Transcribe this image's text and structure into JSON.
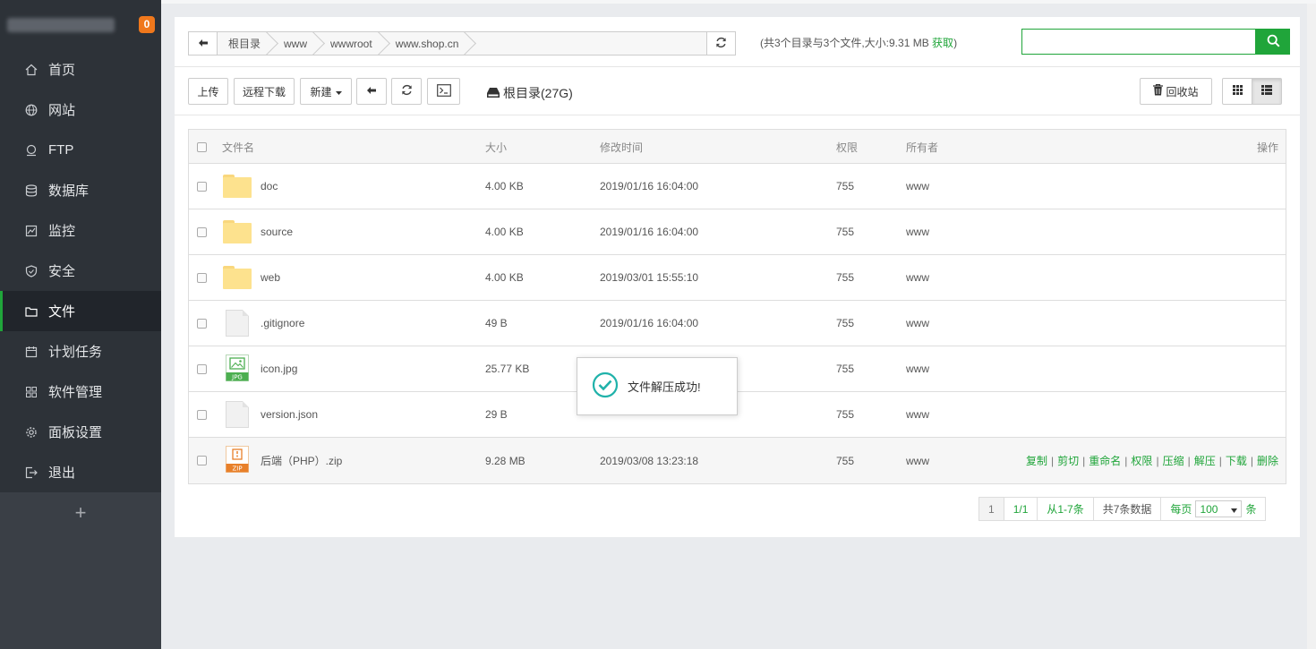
{
  "sidebar": {
    "badge": "0",
    "items": [
      {
        "label": "首页",
        "icon": "home-icon"
      },
      {
        "label": "网站",
        "icon": "globe-icon"
      },
      {
        "label": "FTP",
        "icon": "ftp-icon"
      },
      {
        "label": "数据库",
        "icon": "database-icon"
      },
      {
        "label": "监控",
        "icon": "monitor-icon"
      },
      {
        "label": "安全",
        "icon": "shield-icon"
      },
      {
        "label": "文件",
        "icon": "folder-icon"
      },
      {
        "label": "计划任务",
        "icon": "calendar-icon"
      },
      {
        "label": "软件管理",
        "icon": "grid-icon"
      },
      {
        "label": "面板设置",
        "icon": "gear-icon"
      },
      {
        "label": "退出",
        "icon": "logout-icon"
      }
    ],
    "active_index": 6,
    "add_label": "+"
  },
  "path": {
    "crumbs": [
      "根目录",
      "www",
      "wwwroot",
      "www.shop.cn"
    ],
    "summary": "(共3个目录与3个文件,大小:9.31 MB ",
    "fetch_label": "获取",
    "summary_end": ")"
  },
  "search": {
    "value": "",
    "placeholder": ""
  },
  "toolbar": {
    "upload": "上传",
    "remote_download": "远程下载",
    "new": "新建",
    "disk": "根目录(27G)",
    "recycle": "回收站"
  },
  "table": {
    "headers": {
      "name": "文件名",
      "size": "大小",
      "time": "修改时间",
      "perm": "权限",
      "owner": "所有者",
      "ops": "操作"
    },
    "rows": [
      {
        "name": "doc",
        "size": "4.00 KB",
        "time": "2019/01/16 16:04:00",
        "perm": "755",
        "owner": "www"
      },
      {
        "name": "source",
        "size": "4.00 KB",
        "time": "2019/01/16 16:04:00",
        "perm": "755",
        "owner": "www"
      },
      {
        "name": "web",
        "size": "4.00 KB",
        "time": "2019/03/01 15:55:10",
        "perm": "755",
        "owner": "www"
      },
      {
        "name": ".gitignore",
        "size": "49 B",
        "time": "2019/01/16 16:04:00",
        "perm": "755",
        "owner": "www"
      },
      {
        "name": "icon.jpg",
        "size": "25.77 KB",
        "time": "",
        "perm": "755",
        "owner": "www"
      },
      {
        "name": "version.json",
        "size": "29 B",
        "time": "",
        "perm": "755",
        "owner": "www"
      },
      {
        "name": "后端（PHP）.zip",
        "size": "9.28 MB",
        "time": "2019/03/08 13:23:18",
        "perm": "755",
        "owner": "www"
      }
    ],
    "ops": [
      "复制",
      "剪切",
      "重命名",
      "权限",
      "压缩",
      "解压",
      "下载",
      "删除"
    ],
    "file_badges": {
      "jpg": "JPG",
      "zip": "ZIP"
    }
  },
  "pager": {
    "current": "1",
    "pages": "1/1",
    "range": "从1-7条",
    "total": "共7条数据",
    "per_page_label": "每页",
    "per_page": "100",
    "unit": "条"
  },
  "toast": {
    "message": "文件解压成功!"
  },
  "colors": {
    "accent": "#20a53a",
    "sidebar": "#3a3f46",
    "badge": "#f0781c"
  }
}
